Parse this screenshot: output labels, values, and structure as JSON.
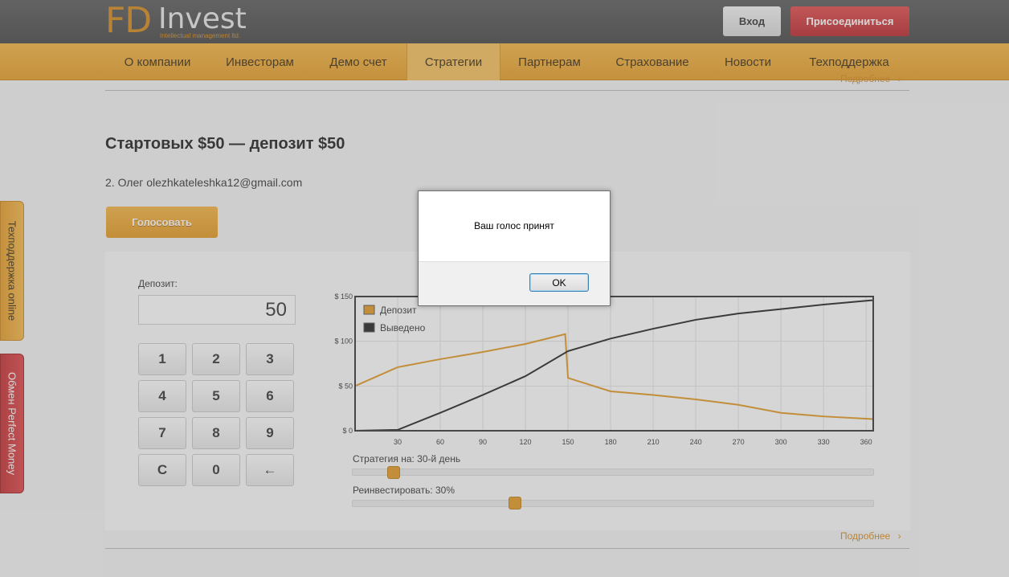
{
  "header": {
    "logo_fd": "FD",
    "logo_invest": "Invest",
    "logo_tagline": "Intellectual management ltd.",
    "login_label": "Вход",
    "join_label": "Присоединиться"
  },
  "nav": {
    "items": [
      {
        "label": "О компании"
      },
      {
        "label": "Инвесторам"
      },
      {
        "label": "Демо счет"
      },
      {
        "label": "Стратегии",
        "active": true
      },
      {
        "label": "Партнерам"
      },
      {
        "label": "Страхование"
      },
      {
        "label": "Новости"
      },
      {
        "label": "Техподдержка"
      }
    ]
  },
  "content": {
    "more_label_top": "Подробнее",
    "more_label_bottom": "Подробнее",
    "title": "Стартовых $50 — депозит $50",
    "voter": "2. Олег olezhkateleshka12@gmail.com",
    "vote_button": "Голосовать"
  },
  "calculator": {
    "deposit_label": "Депозит:",
    "deposit_value": "50",
    "keys": [
      "1",
      "2",
      "3",
      "4",
      "5",
      "6",
      "7",
      "8",
      "9",
      "C",
      "0",
      "←"
    ]
  },
  "chart_data": {
    "type": "line",
    "legend": [
      "Депозит",
      "Выведено"
    ],
    "legend_placement": "top-left",
    "y_ticks": [
      "$ 0",
      "$ 50",
      "$ 100",
      "$ 150"
    ],
    "x_ticks": [
      "30",
      "60",
      "90",
      "120",
      "150",
      "180",
      "210",
      "240",
      "270",
      "300",
      "330",
      "360"
    ],
    "xlim": [
      0,
      365
    ],
    "ylim": [
      0,
      150
    ],
    "grid": true,
    "series": [
      {
        "name": "Депозит",
        "color": "#e4981f",
        "x": [
          0,
          30,
          60,
          90,
          120,
          148,
          150,
          180,
          210,
          240,
          270,
          300,
          330,
          365
        ],
        "y": [
          50,
          71,
          80,
          88,
          97,
          108,
          59,
          44,
          40,
          35,
          29,
          20,
          16,
          13
        ]
      },
      {
        "name": "Выведено",
        "color": "#222222",
        "x": [
          0,
          30,
          60,
          90,
          120,
          150,
          180,
          210,
          240,
          270,
          300,
          330,
          365
        ],
        "y": [
          0,
          1,
          20,
          40,
          61,
          89,
          103,
          114,
          124,
          131,
          136,
          141,
          146
        ]
      }
    ]
  },
  "sliders": {
    "strategy_label": "Стратегия на: 30-й день",
    "strategy_value": 30,
    "strategy_range": [
      30,
      360
    ],
    "reinvest_label": "Реинвестировать: 30%",
    "reinvest_value": 30
  },
  "side_tabs": {
    "support_label": "Техподдержка online",
    "exchange_label": "Обмен Perfect Money"
  },
  "dialog": {
    "message": "Ваш голос принят",
    "ok_label": "OK"
  }
}
